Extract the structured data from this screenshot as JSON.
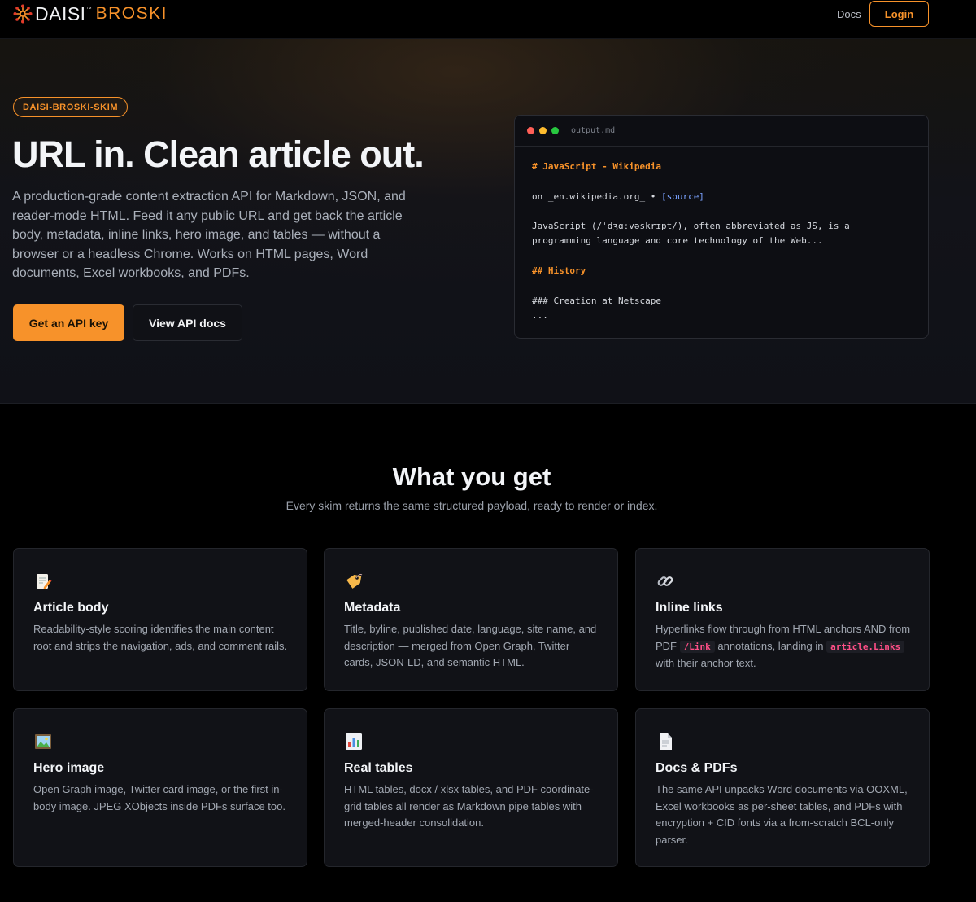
{
  "nav": {
    "brand_primary": "DAISI",
    "brand_tm": "™",
    "brand_secondary": "BROSKI",
    "docs_label": "Docs",
    "login_label": "Login"
  },
  "hero": {
    "pill": "DAISI-BROSKI-SKIM",
    "title": "URL in. Clean article out.",
    "description": "A production-grade content extraction API for Markdown, JSON, and reader-mode HTML. Feed it any public URL and get back the article body, metadata, inline links, hero image, and tables — without a browser or a headless Chrome. Works on HTML pages, Word documents, Excel workbooks, and PDFs.",
    "primary_button": "Get an API key",
    "secondary_button": "View API docs",
    "code_window": {
      "filename": "output.md",
      "line_title": "# JavaScript - Wikipedia",
      "line_source_prefix": "on _en.wikipedia.org_ • ",
      "line_source_link": "[source]",
      "line_body_1": "JavaScript (/ˈdʒɑːvəskrɪpt/), often abbreviated as JS, is a",
      "line_body_2": "programming language and core technology of the Web...",
      "line_h2": "## History",
      "line_h3": "### Creation at Netscape",
      "line_ellipsis": "..."
    }
  },
  "section": {
    "title": "What you get",
    "subtitle": "Every skim returns the same structured payload, ready to render or index."
  },
  "cards": [
    {
      "icon": "memo-icon",
      "title": "Article body",
      "text": "Readability-style scoring identifies the main content root and strips the navigation, ads, and comment rails."
    },
    {
      "icon": "tag-icon",
      "title": "Metadata",
      "text": "Title, byline, published date, language, site name, and description — merged from Open Graph, Twitter cards, JSON-LD, and semantic HTML."
    },
    {
      "icon": "link-icon",
      "title": "Inline links",
      "text_a": "Hyperlinks flow through from HTML anchors AND from PDF ",
      "code_a": "/Link",
      "text_b": " annotations, landing in ",
      "code_b": "article.Links",
      "text_c": " with their anchor text."
    },
    {
      "icon": "picture-icon",
      "title": "Hero image",
      "text": "Open Graph image, Twitter card image, or the first in-body image. JPEG XObjects inside PDFs surface too."
    },
    {
      "icon": "bar-chart-icon",
      "title": "Real tables",
      "text": "HTML tables, docx / xlsx tables, and PDF coordinate-grid tables all render as Markdown pipe tables with merged-header consolidation."
    },
    {
      "icon": "document-icon",
      "title": "Docs & PDFs",
      "text": "The same API unpacks Word documents via OOXML, Excel workbooks as per-sheet tables, and PDFs with encryption + CID fonts via a from-scratch BCL-only parser."
    }
  ]
}
